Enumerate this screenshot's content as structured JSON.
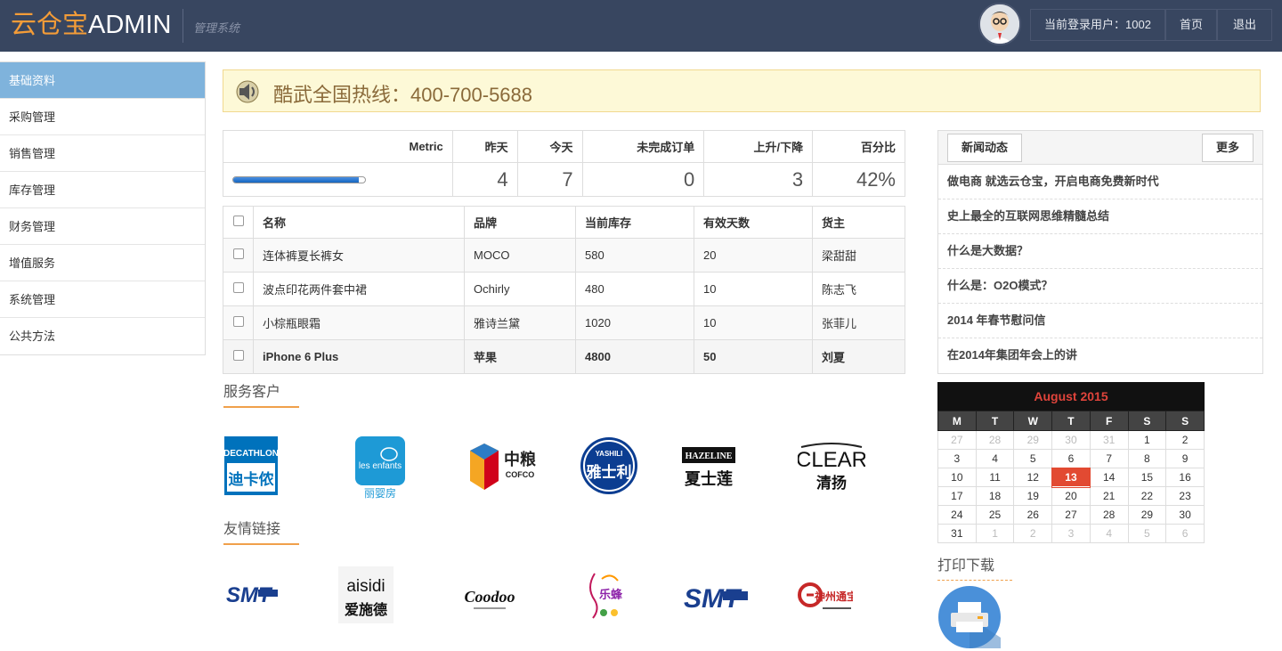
{
  "header": {
    "brand_cn": "云仓宝",
    "brand_en": "ADMIN",
    "subtitle": "管理系统",
    "user_label": "当前登录用户：1002",
    "home_label": "首页",
    "logout_label": "退出"
  },
  "sidebar": {
    "items": [
      {
        "label": "基础资料"
      },
      {
        "label": "采购管理"
      },
      {
        "label": "销售管理"
      },
      {
        "label": "库存管理"
      },
      {
        "label": "财务管理"
      },
      {
        "label": "增值服务"
      },
      {
        "label": "系统管理"
      },
      {
        "label": "公共方法"
      }
    ]
  },
  "hotline": {
    "text": "酷武全国热线：400-700-5688"
  },
  "metric": {
    "headers": [
      "Metric",
      "昨天",
      "今天",
      "未完成订单",
      "上升/下降",
      "百分比"
    ],
    "progress": 0.95,
    "values": [
      "4",
      "7",
      "0",
      "3",
      "42%"
    ]
  },
  "products": {
    "headers": [
      "名称",
      "品牌",
      "当前库存",
      "有效天数",
      "货主"
    ],
    "rows": [
      [
        "连体裤夏长裤女",
        "MOCO",
        "580",
        "20",
        "梁甜甜"
      ],
      [
        "波点印花两件套中裙",
        "Ochirly",
        "480",
        "10",
        "陈志飞"
      ],
      [
        "小棕瓶眼霜",
        "雅诗兰黛",
        "1020",
        "10",
        "张菲儿"
      ],
      [
        "iPhone 6 Plus",
        "苹果",
        "4800",
        "50",
        "刘夏"
      ]
    ]
  },
  "clients": {
    "title": "服务客户",
    "logos": [
      {
        "name": "DECATHLON",
        "cn": "迪卡侬"
      },
      {
        "name": "les enfants",
        "cn": "丽婴房"
      },
      {
        "name": "中粮",
        "en": "COFCO"
      },
      {
        "name": "YASHILI",
        "cn": "雅士利"
      },
      {
        "name": "HAZELINE",
        "cn": "夏士莲"
      },
      {
        "name": "CLEAR",
        "cn": "清扬"
      }
    ]
  },
  "links": {
    "title": "友情链接",
    "logos": [
      {
        "name": "SMT"
      },
      {
        "name": "aisidi",
        "cn": "爱施德"
      },
      {
        "name": "Coodoo"
      },
      {
        "name": "乐蜂"
      },
      {
        "name": "SMT"
      },
      {
        "name": "神州通宝"
      }
    ]
  },
  "news": {
    "tab_label": "新闻动态",
    "more_label": "更多",
    "items": [
      "做电商 就选云仓宝，开启电商免费新时代",
      "史上最全的互联网思维精髓总结",
      "什么是大数据？",
      "什么是：O2O模式？",
      "2014 年春节慰问信",
      "在2014年集团年会上的讲"
    ]
  },
  "calendar": {
    "title": "August 2015",
    "weekdays": [
      "M",
      "T",
      "W",
      "T",
      "F",
      "S",
      "S"
    ],
    "weeks": [
      [
        "27",
        "28",
        "29",
        "30",
        "31",
        "1",
        "2"
      ],
      [
        "3",
        "4",
        "5",
        "6",
        "7",
        "8",
        "9"
      ],
      [
        "10",
        "11",
        "12",
        "13",
        "14",
        "15",
        "16"
      ],
      [
        "17",
        "18",
        "19",
        "20",
        "21",
        "22",
        "23"
      ],
      [
        "24",
        "25",
        "26",
        "27",
        "28",
        "29",
        "30"
      ],
      [
        "31",
        "1",
        "2",
        "3",
        "4",
        "5",
        "6"
      ]
    ],
    "today": "13"
  },
  "print": {
    "title": "打印下载"
  }
}
